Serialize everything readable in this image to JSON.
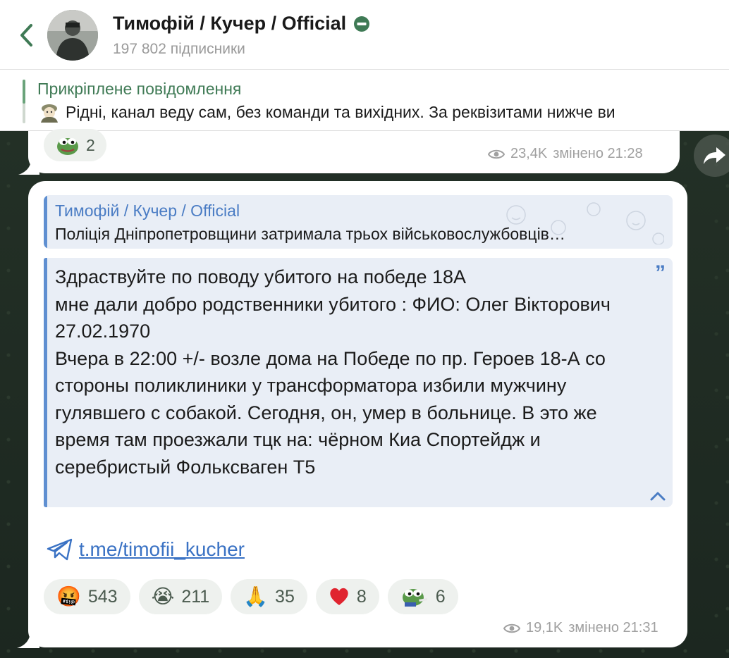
{
  "header": {
    "channel_name": "Тимофій / Кучер / Official",
    "subscribers": "197 802 підписники"
  },
  "pinned": {
    "title": "Прикріплене повідомлення",
    "text": "Рідні, канал веду сам, без команди та вихідних. За реквізитами нижче ви"
  },
  "message1": {
    "reaction": {
      "icon": "pepe-frog-emoji",
      "count": "2"
    },
    "views": "23,4K",
    "edited_time": "змінено 21:28"
  },
  "message2": {
    "reply": {
      "author": "Тимофій / Кучер / Official",
      "text": "Поліція Дніпропетровщини затримала трьох військовослужбовців…"
    },
    "quote_text": "Здраствуйте по поводу убитого на победе 18А\nмне дали добро родственники убитого : ФИО: Олег Вікторович\n27.02.1970\nВчера в 22:00 +/- возле дома на Победе по пр. Героев 18-А со стороны поликлиники у трансформатора избили мужчину гулявшего с собакой. Сегодня, он, умер в больнице. В это же время там проезжали тцк на: чёрном Киа Спортейдж и серебристый Фольксваген Т5",
    "link": "t.me/timofii_kucher",
    "reactions": [
      {
        "icon": "angry-face-emoji",
        "emoji": "🤬",
        "count": "543"
      },
      {
        "icon": "crying-face-emoji",
        "emoji": "😭",
        "count": "211"
      },
      {
        "icon": "folded-hands-emoji",
        "emoji": "🙏",
        "count": "35"
      },
      {
        "icon": "red-heart-emoji",
        "emoji": "❤️",
        "count": "8"
      },
      {
        "icon": "pepe-frog-emoji",
        "emoji": "",
        "count": "6"
      }
    ],
    "views": "19,1K",
    "edited_time": "змінено 21:31"
  },
  "colors": {
    "accent_green": "#3f7a55",
    "link_blue": "#3a72c4",
    "quote_bg": "#e9eef6",
    "chat_bg": "#1f2a22"
  }
}
